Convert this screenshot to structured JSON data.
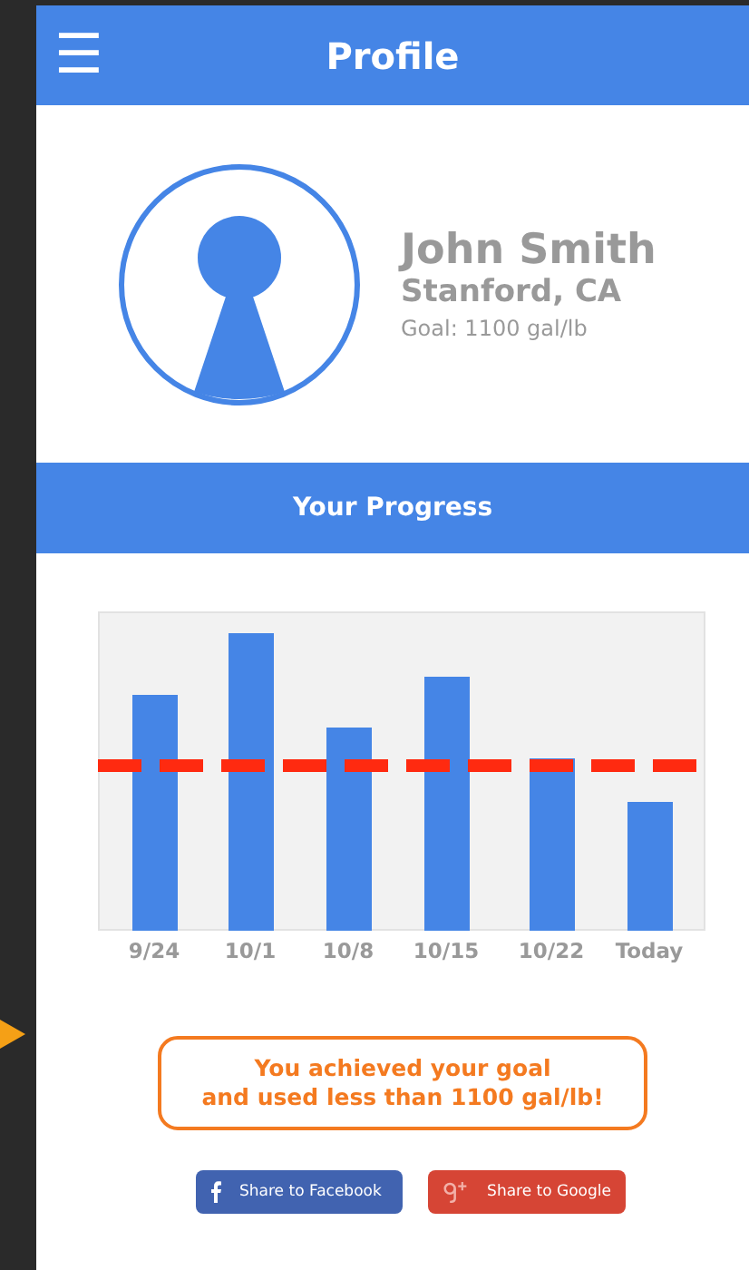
{
  "header": {
    "menu_icon": "☰",
    "title": "Profile"
  },
  "profile": {
    "name": "John Smith",
    "location": "Stanford, CA",
    "goal": "Goal: 1100 gal/lb"
  },
  "progress": {
    "title": "Your Progress",
    "x_labels": [
      "9/24",
      "10/1",
      "10/8",
      "10/15",
      "10/22",
      "Today"
    ]
  },
  "message": {
    "lines": [
      "You achieved your goal",
      "and used less than 1100 gal/lb!"
    ]
  },
  "share_buttons": [
    {
      "kind": "facebook",
      "label": "Share to Facebook"
    },
    {
      "kind": "google",
      "label": "Share to Google"
    }
  ]
}
